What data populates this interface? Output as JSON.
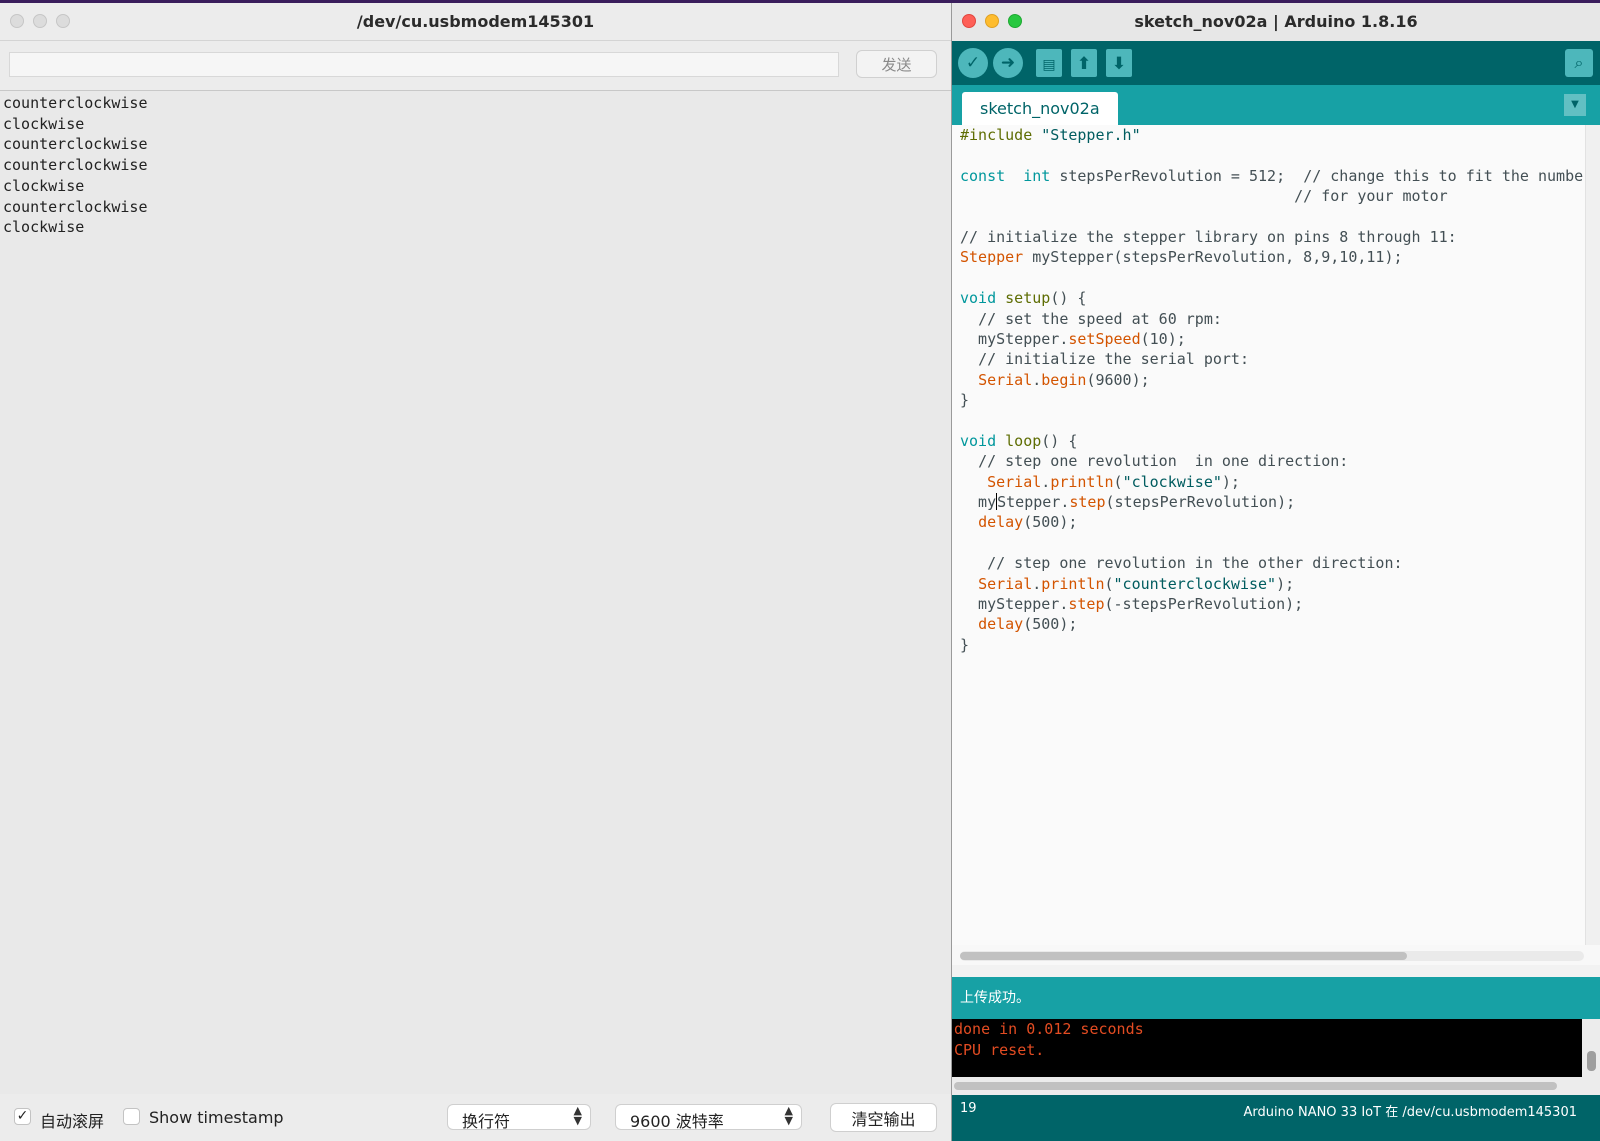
{
  "serial_monitor": {
    "title": "/dev/cu.usbmodem145301",
    "send_input": {
      "value": "",
      "placeholder": ""
    },
    "send_button": "发送",
    "output_lines": [
      "counterclockwise",
      "clockwise",
      "counterclockwise",
      "counterclockwise",
      "clockwise",
      "counterclockwise",
      "clockwise"
    ],
    "autoscroll": {
      "label": "自动滚屏",
      "checked": true
    },
    "timestamp": {
      "label": "Show timestamp",
      "checked": false
    },
    "line_ending": "换行符",
    "baud_rate": "9600 波特率",
    "clear_button": "清空输出"
  },
  "ide": {
    "title": "sketch_nov02a | Arduino 1.8.16",
    "tab": "sketch_nov02a",
    "status": "上传成功。",
    "console": [
      "done in 0.012 seconds",
      "CPU reset."
    ],
    "line_number": "19",
    "board": "Arduino NANO 33 IoT 在 /dev/cu.usbmodem145301",
    "accent_color": "#006468",
    "toolbar_color": "#17a1a5",
    "code": [
      [
        [
          "pp",
          "#include"
        ],
        [
          "st",
          " \"Stepper.h\""
        ]
      ],
      [],
      [
        [
          "kw",
          "const"
        ],
        [
          "",
          "  "
        ],
        [
          "kw",
          "int"
        ],
        [
          "",
          " stepsPerRevolution = 512;  "
        ],
        [
          "cm",
          "// change this to fit the number"
        ]
      ],
      [
        [
          "",
          "                                     "
        ],
        [
          "cm",
          "// for your motor"
        ]
      ],
      [],
      [
        [
          "cm",
          "// initialize the stepper library on pins 8 through 11:"
        ]
      ],
      [
        [
          "fn",
          "Stepper"
        ],
        [
          "",
          " myStepper(stepsPerRevolution, 8,9,10,11);"
        ]
      ],
      [],
      [
        [
          "kw",
          "void"
        ],
        [
          "",
          " "
        ],
        [
          "pp",
          "setup"
        ],
        [
          "",
          "() {"
        ]
      ],
      [
        [
          "",
          "  "
        ],
        [
          "cm",
          "// set the speed at 60 rpm:"
        ]
      ],
      [
        [
          "",
          "  myStepper."
        ],
        [
          "fn",
          "setSpeed"
        ],
        [
          "",
          "(10);"
        ]
      ],
      [
        [
          "",
          "  "
        ],
        [
          "cm",
          "// initialize the serial port:"
        ]
      ],
      [
        [
          "",
          "  "
        ],
        [
          "fn",
          "Serial"
        ],
        [
          "",
          "."
        ],
        [
          "fn",
          "begin"
        ],
        [
          "",
          "(9600);"
        ]
      ],
      [
        [
          "",
          "}"
        ]
      ],
      [],
      [
        [
          "kw",
          "void"
        ],
        [
          "",
          " "
        ],
        [
          "pp",
          "loop"
        ],
        [
          "",
          "() {"
        ]
      ],
      [
        [
          "",
          "  "
        ],
        [
          "cm",
          "// step one revolution  in one direction:"
        ]
      ],
      [
        [
          "",
          "   "
        ],
        [
          "fn",
          "Serial"
        ],
        [
          "",
          "."
        ],
        [
          "fn",
          "println"
        ],
        [
          "",
          "("
        ],
        [
          "st",
          "\"clockwise\""
        ],
        [
          "",
          ");"
        ]
      ],
      [
        [
          "",
          "  my"
        ],
        [
          "caret",
          ""
        ],
        [
          "",
          "Stepper."
        ],
        [
          "fn",
          "step"
        ],
        [
          "",
          "(stepsPerRevolution);"
        ]
      ],
      [
        [
          "",
          "  "
        ],
        [
          "fn",
          "delay"
        ],
        [
          "",
          "(500);"
        ]
      ],
      [],
      [
        [
          "",
          "   "
        ],
        [
          "cm",
          "// step one revolution in the other direction:"
        ]
      ],
      [
        [
          "",
          "  "
        ],
        [
          "fn",
          "Serial"
        ],
        [
          "",
          "."
        ],
        [
          "fn",
          "println"
        ],
        [
          "",
          "("
        ],
        [
          "st",
          "\"counterclockwise\""
        ],
        [
          "",
          ");"
        ]
      ],
      [
        [
          "",
          "  myStepper."
        ],
        [
          "fn",
          "step"
        ],
        [
          "",
          "(-stepsPerRevolution);"
        ]
      ],
      [
        [
          "",
          "  "
        ],
        [
          "fn",
          "delay"
        ],
        [
          "",
          "(500);"
        ]
      ],
      [
        [
          "",
          "}"
        ]
      ]
    ]
  }
}
